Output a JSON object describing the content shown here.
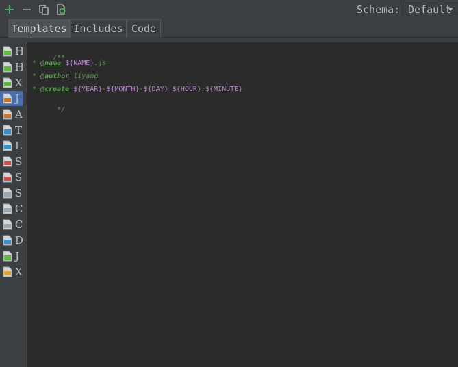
{
  "toolbar": {
    "add": "add-icon",
    "remove": "remove-icon",
    "copy": "copy-icon",
    "reset": "reset-icon",
    "schema_label": "Schema:",
    "schema_value": "Default"
  },
  "tabs": [
    {
      "label": "Templates",
      "active": true
    },
    {
      "label": "Includes",
      "active": false
    },
    {
      "label": "Code",
      "active": false
    }
  ],
  "templates": [
    {
      "icon": "html-file-icon",
      "label": "H",
      "color": "#62b543"
    },
    {
      "icon": "html-file-icon",
      "label": "H",
      "color": "#62b543"
    },
    {
      "icon": "xhtml-file-icon",
      "label": "X",
      "color": "#62b543"
    },
    {
      "icon": "javascript-file-icon",
      "label": "J",
      "color": "#c57633",
      "selected": true
    },
    {
      "icon": "actionscript-file-icon",
      "label": "A",
      "color": "#c57633"
    },
    {
      "icon": "typescript-file-icon",
      "label": "T",
      "color": "#3592c4"
    },
    {
      "icon": "less-file-icon",
      "label": "L",
      "color": "#3592c4"
    },
    {
      "icon": "sass-file-icon",
      "label": "S",
      "color": "#c75450"
    },
    {
      "icon": "scss-file-icon",
      "label": "S",
      "color": "#c75450"
    },
    {
      "icon": "stylus-file-icon",
      "label": "S",
      "color": "#9aa7b0"
    },
    {
      "icon": "coffeescript-file-icon",
      "label": "C",
      "color": "#9aa7b0"
    },
    {
      "icon": "coffeescript-class-icon",
      "label": "C",
      "color": "#9aa7b0"
    },
    {
      "icon": "dart-file-icon",
      "label": "D",
      "color": "#3592c4"
    },
    {
      "icon": "jade-file-icon",
      "label": "J",
      "color": "#62b543"
    },
    {
      "icon": "xslt-file-icon",
      "label": "X",
      "color": "#e0a530"
    }
  ],
  "editor": {
    "open": "/**",
    "name_tag": "@name",
    "name_var": "${NAME}",
    "name_ext": ".js",
    "author_tag": "@author",
    "author_val": "liyang",
    "create_tag": "@create",
    "create_year": "${YEAR}",
    "create_month": "${MONTH}",
    "create_day": "${DAY}",
    "create_hour": "${HOUR}",
    "create_minute": "${MINUTE}",
    "dash": "-",
    "colon": ":",
    "star": " * ",
    "close": " */"
  }
}
